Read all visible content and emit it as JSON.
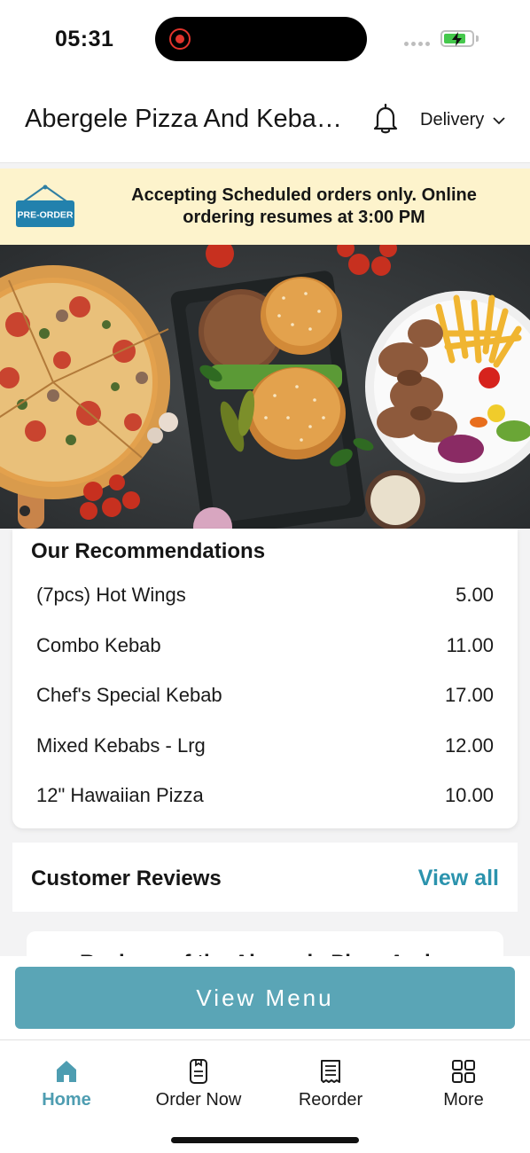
{
  "status_bar": {
    "time": "05:31",
    "battery_level": 0.8,
    "battery_color": "#45c84c",
    "recording_color": "#e2342c"
  },
  "header": {
    "title": "Abergele Pizza And Kebab House",
    "bell_icon": "bell-icon",
    "delivery_label": "Delivery",
    "chevron_icon": "chevron-down-icon"
  },
  "banner": {
    "tag_label": "PRE-ORDER",
    "message": "Accepting Scheduled orders only. Online ordering resumes at 3:00 PM",
    "background": "#fdf3cc"
  },
  "recommendations": {
    "title": "Our Recommendations",
    "items": [
      {
        "name": "(7pcs) Hot Wings",
        "price": "5.00"
      },
      {
        "name": "Combo Kebab",
        "price": "11.00"
      },
      {
        "name": "Chef's Special Kebab",
        "price": "17.00"
      },
      {
        "name": "Mixed Kebabs - Lrg",
        "price": "12.00"
      },
      {
        "name": "12\" Hawaiian Pizza",
        "price": "10.00"
      }
    ]
  },
  "reviews": {
    "title": "Customer Reviews",
    "view_all": "View all",
    "preview_text": "Reviews of the Abergele Pizza And"
  },
  "view_menu_label": "View Menu",
  "accent_color": "#5aa5b6",
  "tabs": [
    {
      "label": "Home",
      "icon": "home-icon",
      "active": true
    },
    {
      "label": "Order Now",
      "icon": "phone-order-icon",
      "active": false
    },
    {
      "label": "Reorder",
      "icon": "receipt-icon",
      "active": false
    },
    {
      "label": "More",
      "icon": "grid-icon",
      "active": false
    }
  ]
}
